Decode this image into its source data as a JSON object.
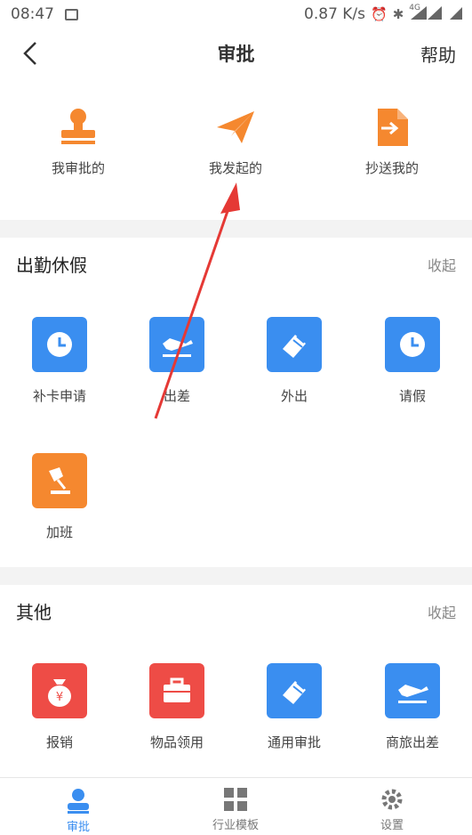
{
  "status_bar": {
    "time": "08:47",
    "speed": "0.87 K/s",
    "network": "4G"
  },
  "header": {
    "title": "审批",
    "help": "帮助"
  },
  "top_items": [
    {
      "label": "我审批的",
      "icon": "stamp-icon"
    },
    {
      "label": "我发起的",
      "icon": "paper-plane-icon"
    },
    {
      "label": "抄送我的",
      "icon": "forward-doc-icon"
    }
  ],
  "attendance": {
    "title": "出勤休假",
    "collapse": "收起",
    "items": [
      {
        "label": "补卡申请",
        "icon": "clock-icon"
      },
      {
        "label": "出差",
        "icon": "plane-icon"
      },
      {
        "label": "外出",
        "icon": "eraser-icon"
      },
      {
        "label": "请假",
        "icon": "clock-icon"
      },
      {
        "label": "加班",
        "icon": "lamp-icon"
      }
    ]
  },
  "other": {
    "title": "其他",
    "collapse": "收起",
    "items": [
      {
        "label": "报销",
        "icon": "money-bag-icon"
      },
      {
        "label": "物品领用",
        "icon": "toolbox-icon"
      },
      {
        "label": "通用审批",
        "icon": "eraser-icon"
      },
      {
        "label": "商旅出差",
        "icon": "plane-icon"
      }
    ]
  },
  "tabs": [
    {
      "label": "审批",
      "icon": "person-icon"
    },
    {
      "label": "行业模板",
      "icon": "grid-icon"
    },
    {
      "label": "设置",
      "icon": "gear-icon"
    }
  ],
  "colors": {
    "accent": "#3a8ef0",
    "orange": "#f5882f",
    "red": "#ee4c46",
    "annotation": "#e53935"
  }
}
